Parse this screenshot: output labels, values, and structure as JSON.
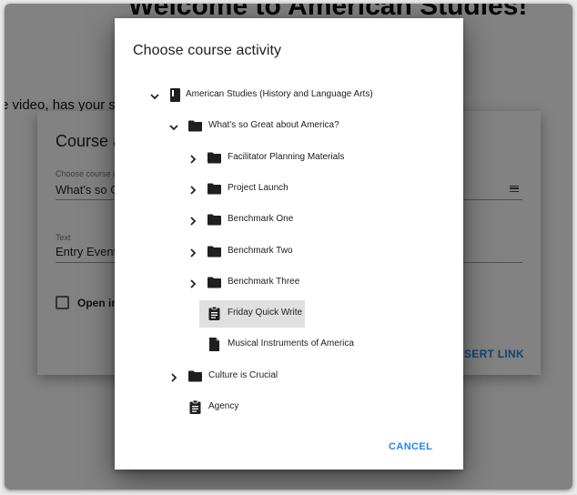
{
  "background_page": {
    "heading": "Welcome to American Studies!",
    "text": "e video, has your s"
  },
  "background_dialog": {
    "title": "Course a",
    "field1_label": "Choose course a",
    "field1_value": "What's so Gr",
    "field2_label": "Text",
    "field2_value": "Entry Event",
    "checkbox_label": "Open in",
    "insert_button": "INSERT LINK"
  },
  "modal": {
    "title": "Choose course activity",
    "cancel_label": "CANCEL",
    "accent_color": "#1e88e5",
    "tree": [
      {
        "label": "American Studies (History and Language Arts)",
        "icon": "book-icon",
        "expand": "chevron-down-icon"
      },
      {
        "label": "What's so Great about America?",
        "icon": "folder-icon",
        "expand": "chevron-down-icon"
      },
      {
        "label": "Facilitator Planning Materials",
        "icon": "folder-icon",
        "expand": "chevron-right-icon"
      },
      {
        "label": "Project Launch",
        "icon": "folder-icon",
        "expand": "chevron-right-icon"
      },
      {
        "label": "Benchmark One",
        "icon": "folder-icon",
        "expand": "chevron-right-icon"
      },
      {
        "label": "Benchmark Two",
        "icon": "folder-icon",
        "expand": "chevron-right-icon"
      },
      {
        "label": "Benchmark Three",
        "icon": "folder-icon",
        "expand": "chevron-right-icon"
      },
      {
        "label": "Friday Quick Write",
        "icon": "assignment-icon",
        "selected": true
      },
      {
        "label": "Musical Instruments of America",
        "icon": "document-icon"
      },
      {
        "label": "Culture is Crucial",
        "icon": "folder-icon",
        "expand": "chevron-right-icon"
      },
      {
        "label": "Agency",
        "icon": "assignment-icon"
      }
    ]
  }
}
